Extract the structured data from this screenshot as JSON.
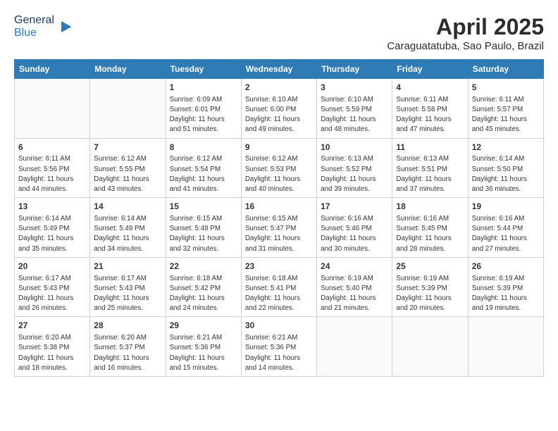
{
  "header": {
    "logo_line1": "General",
    "logo_line2": "Blue",
    "month": "April 2025",
    "location": "Caraguatatuba, Sao Paulo, Brazil"
  },
  "weekdays": [
    "Sunday",
    "Monday",
    "Tuesday",
    "Wednesday",
    "Thursday",
    "Friday",
    "Saturday"
  ],
  "weeks": [
    [
      {
        "day": "",
        "info": ""
      },
      {
        "day": "",
        "info": ""
      },
      {
        "day": "1",
        "info": "Sunrise: 6:09 AM\nSunset: 6:01 PM\nDaylight: 11 hours and 51 minutes."
      },
      {
        "day": "2",
        "info": "Sunrise: 6:10 AM\nSunset: 6:00 PM\nDaylight: 11 hours and 49 minutes."
      },
      {
        "day": "3",
        "info": "Sunrise: 6:10 AM\nSunset: 5:59 PM\nDaylight: 11 hours and 48 minutes."
      },
      {
        "day": "4",
        "info": "Sunrise: 6:11 AM\nSunset: 5:58 PM\nDaylight: 11 hours and 47 minutes."
      },
      {
        "day": "5",
        "info": "Sunrise: 6:11 AM\nSunset: 5:57 PM\nDaylight: 11 hours and 45 minutes."
      }
    ],
    [
      {
        "day": "6",
        "info": "Sunrise: 6:11 AM\nSunset: 5:56 PM\nDaylight: 11 hours and 44 minutes."
      },
      {
        "day": "7",
        "info": "Sunrise: 6:12 AM\nSunset: 5:55 PM\nDaylight: 11 hours and 43 minutes."
      },
      {
        "day": "8",
        "info": "Sunrise: 6:12 AM\nSunset: 5:54 PM\nDaylight: 11 hours and 41 minutes."
      },
      {
        "day": "9",
        "info": "Sunrise: 6:12 AM\nSunset: 5:53 PM\nDaylight: 11 hours and 40 minutes."
      },
      {
        "day": "10",
        "info": "Sunrise: 6:13 AM\nSunset: 5:52 PM\nDaylight: 11 hours and 39 minutes."
      },
      {
        "day": "11",
        "info": "Sunrise: 6:13 AM\nSunset: 5:51 PM\nDaylight: 11 hours and 37 minutes."
      },
      {
        "day": "12",
        "info": "Sunrise: 6:14 AM\nSunset: 5:50 PM\nDaylight: 11 hours and 36 minutes."
      }
    ],
    [
      {
        "day": "13",
        "info": "Sunrise: 6:14 AM\nSunset: 5:49 PM\nDaylight: 11 hours and 35 minutes."
      },
      {
        "day": "14",
        "info": "Sunrise: 6:14 AM\nSunset: 5:49 PM\nDaylight: 11 hours and 34 minutes."
      },
      {
        "day": "15",
        "info": "Sunrise: 6:15 AM\nSunset: 5:48 PM\nDaylight: 11 hours and 32 minutes."
      },
      {
        "day": "16",
        "info": "Sunrise: 6:15 AM\nSunset: 5:47 PM\nDaylight: 11 hours and 31 minutes."
      },
      {
        "day": "17",
        "info": "Sunrise: 6:16 AM\nSunset: 5:46 PM\nDaylight: 11 hours and 30 minutes."
      },
      {
        "day": "18",
        "info": "Sunrise: 6:16 AM\nSunset: 5:45 PM\nDaylight: 11 hours and 28 minutes."
      },
      {
        "day": "19",
        "info": "Sunrise: 6:16 AM\nSunset: 5:44 PM\nDaylight: 11 hours and 27 minutes."
      }
    ],
    [
      {
        "day": "20",
        "info": "Sunrise: 6:17 AM\nSunset: 5:43 PM\nDaylight: 11 hours and 26 minutes."
      },
      {
        "day": "21",
        "info": "Sunrise: 6:17 AM\nSunset: 5:43 PM\nDaylight: 11 hours and 25 minutes."
      },
      {
        "day": "22",
        "info": "Sunrise: 6:18 AM\nSunset: 5:42 PM\nDaylight: 11 hours and 24 minutes."
      },
      {
        "day": "23",
        "info": "Sunrise: 6:18 AM\nSunset: 5:41 PM\nDaylight: 11 hours and 22 minutes."
      },
      {
        "day": "24",
        "info": "Sunrise: 6:19 AM\nSunset: 5:40 PM\nDaylight: 11 hours and 21 minutes."
      },
      {
        "day": "25",
        "info": "Sunrise: 6:19 AM\nSunset: 5:39 PM\nDaylight: 11 hours and 20 minutes."
      },
      {
        "day": "26",
        "info": "Sunrise: 6:19 AM\nSunset: 5:39 PM\nDaylight: 11 hours and 19 minutes."
      }
    ],
    [
      {
        "day": "27",
        "info": "Sunrise: 6:20 AM\nSunset: 5:38 PM\nDaylight: 11 hours and 18 minutes."
      },
      {
        "day": "28",
        "info": "Sunrise: 6:20 AM\nSunset: 5:37 PM\nDaylight: 11 hours and 16 minutes."
      },
      {
        "day": "29",
        "info": "Sunrise: 6:21 AM\nSunset: 5:36 PM\nDaylight: 11 hours and 15 minutes."
      },
      {
        "day": "30",
        "info": "Sunrise: 6:21 AM\nSunset: 5:36 PM\nDaylight: 11 hours and 14 minutes."
      },
      {
        "day": "",
        "info": ""
      },
      {
        "day": "",
        "info": ""
      },
      {
        "day": "",
        "info": ""
      }
    ]
  ]
}
